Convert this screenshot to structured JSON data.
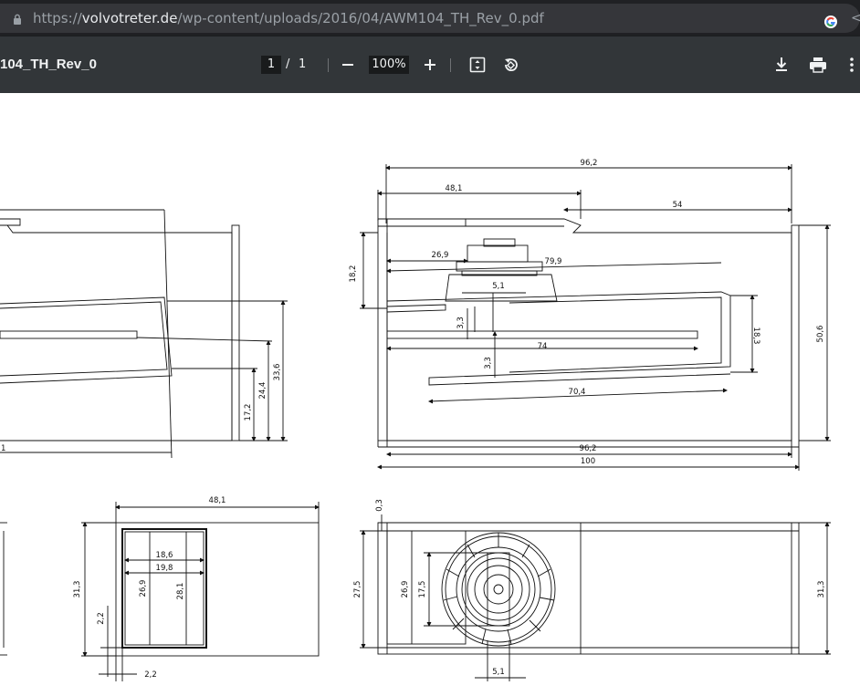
{
  "browser": {
    "url_host": "volvotreter.de",
    "url_scheme": "https://",
    "url_path": "/wp-content/uploads/2016/04/AWM104_TH_Rev_0.pdf"
  },
  "viewer": {
    "title": "104_TH_Rev_0",
    "current_page": "1",
    "separator": "/",
    "total_pages": "1",
    "zoom": "100%"
  },
  "drawing": {
    "dims_top_right": {
      "d96_2_top": "96,2",
      "d48_1": "48,1",
      "d54": "54",
      "d26_9": "26,9",
      "d79_9": "79,9",
      "d18_2": "18,2",
      "d5_1": "5,1",
      "d3_3_a": "3,3",
      "d74": "74",
      "d3_3_b": "3,3",
      "d18_3": "18,3",
      "d50_6": "50,6",
      "d70_4": "70,4",
      "d96_2_bottom": "96,2",
      "d100": "100"
    },
    "dims_top_left": {
      "d17_2": "17,2",
      "d24_4": "24,4",
      "d33_6": "33,6",
      "d1": "1"
    },
    "dims_bottom_mid": {
      "d48_1": "48,1",
      "d31_3": "31,3",
      "d18_6": "18,6",
      "d19_8": "19,8",
      "d26_9": "26,9",
      "d28_1": "28,1",
      "d2_2_v": "2,2",
      "d2_2_h": "2,2"
    },
    "dims_bottom_right": {
      "d0_3": "0,3",
      "d27_5": "27,5",
      "d26_9": "26,9",
      "d17_5": "17,5",
      "d31_3": "31,3",
      "d5_1": "5,1"
    }
  }
}
